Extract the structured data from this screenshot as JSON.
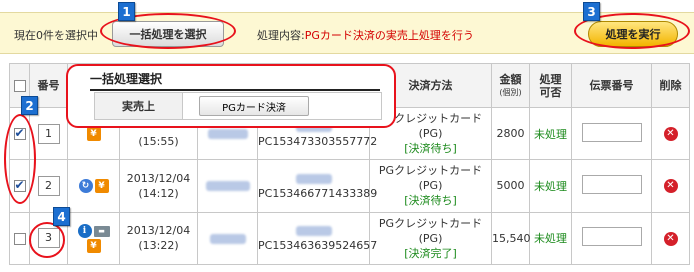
{
  "topbar": {
    "selection_status": "現在0件を選択中",
    "bulk_button": "一括処理を選択",
    "process_label": "処理内容:",
    "process_value": "PGカード決済の実売上処理を行う",
    "execute_button": "処理を実行"
  },
  "markers": [
    "1",
    "2",
    "3",
    "4"
  ],
  "table": {
    "headers": {
      "checkbox": "",
      "number": "番号",
      "payment_method": "決済方法",
      "amount": "金額",
      "amount_sub": "(個別)",
      "processing": "処理",
      "processing_sub": "可否",
      "slip_number": "伝票番号",
      "delete": "削除"
    },
    "rows": [
      {
        "checked": true,
        "number": "1",
        "icons": [
          "yen-icon"
        ],
        "date": "",
        "time": "(15:55)",
        "customer": "",
        "transaction_id": "PC153473303557772",
        "payment_method": "PGクレジットカード(PG)",
        "payment_status": "[決済待ち]",
        "amount": "2800",
        "processing_status": "未処理"
      },
      {
        "checked": true,
        "number": "2",
        "icons": [
          "refresh-icon",
          "yen-icon"
        ],
        "date": "2013/12/04",
        "time": "(14:12)",
        "customer": "",
        "transaction_id": "PC153466771433389",
        "payment_method": "PGクレジットカード(PG)",
        "payment_status": "[決済待ち]",
        "amount": "5000",
        "processing_status": "未処理"
      },
      {
        "checked": false,
        "number": "3",
        "icons": [
          "info-icon",
          "truck-icon",
          "yen-icon"
        ],
        "date": "2013/12/04",
        "time": "(13:22)",
        "customer": "",
        "transaction_id": "PC153463639524657",
        "payment_method": "PGクレジットカード(PG)",
        "payment_status": "[決済完了]",
        "amount": "15,540",
        "processing_status": "未処理"
      }
    ]
  },
  "popup": {
    "title": "一括処理選択",
    "row_label": "実売上",
    "option_button": "PGカード決済"
  },
  "colors": {
    "accent_red": "#e8121c",
    "marker_blue": "#1c6fd1",
    "status_green": "#1b8a1b",
    "topbar_bg": "#fdf8d3"
  }
}
